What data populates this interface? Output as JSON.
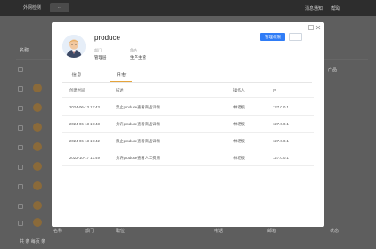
{
  "background": {
    "app_title": "外网检测",
    "chip_label": "…",
    "top_right": [
      "消息通知",
      "帮助"
    ],
    "table_header_first": "名称",
    "right_tag": "产品",
    "bottom_row": [
      "名称",
      "部门",
      "职位",
      "电话",
      "邮箱",
      "状态"
    ],
    "pagination": "共 条   每页 条"
  },
  "profile": {
    "name": "produce",
    "fields": [
      {
        "label": "部门",
        "value": "管理层"
      },
      {
        "label": "角色",
        "value": "生产主管"
      }
    ],
    "primary_button": "管理权限",
    "more_button": "···"
  },
  "tabs": [
    {
      "label": "信息",
      "active": false
    },
    {
      "label": "日志",
      "active": true
    }
  ],
  "table": {
    "columns": [
      "创建时间",
      "描述",
      "操作人",
      "IP"
    ],
    "rows": [
      [
        "2024-06-13 17:43",
        "禁止produce查看商品详情",
        "林老板",
        "127.0.0.1"
      ],
      [
        "2024-06-13 17:43",
        "允许produce查看商品详情",
        "林老板",
        "127.0.0.1"
      ],
      [
        "2024-06-13 17:42",
        "禁止produce查看商品详情",
        "林老板",
        "127.0.0.1"
      ],
      [
        "2022-10-17 13:49",
        "允许produce查看人工费用",
        "林老板",
        "127.0.0.1"
      ]
    ]
  },
  "colors": {
    "accent": "#2f7cf6",
    "tab_underline": "#e5a43c"
  }
}
